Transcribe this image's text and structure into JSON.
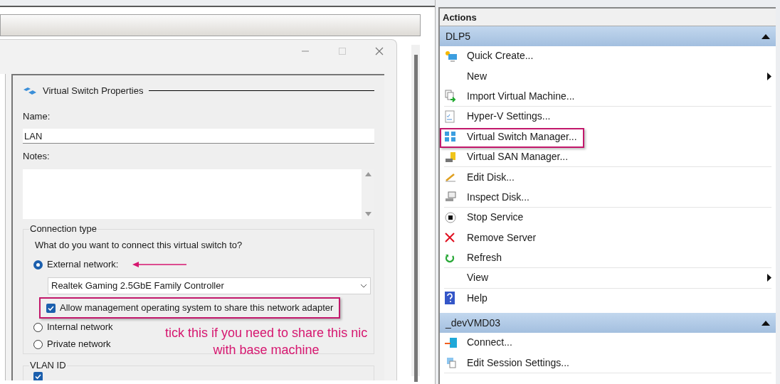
{
  "dialog": {
    "section_title": "Virtual Switch Properties",
    "name_label": "Name:",
    "name_value": "LAN",
    "notes_label": "Notes:",
    "connection_type": {
      "legend": "Connection type",
      "question": "What do you want to connect this virtual switch to?",
      "options": [
        {
          "label": "External network:",
          "selected": true,
          "arrow": true
        },
        {
          "label": "Internal network",
          "selected": false,
          "arrow": false
        },
        {
          "label": "Private network",
          "selected": false,
          "arrow": false
        }
      ],
      "adapter": "Realtek Gaming 2.5GbE Family Controller",
      "share_checkbox": {
        "label": "Allow management operating system to share this network adapter",
        "checked": true,
        "highlighted": true
      }
    },
    "vlan": {
      "legend": "VLAN ID",
      "checked": true
    }
  },
  "annotation": [
    "tick this if you need to share this nic",
    "with base machine"
  ],
  "actions": {
    "title": "Actions",
    "groups": [
      {
        "name": "DLP5",
        "expanded": true,
        "items": [
          {
            "label": "Quick Create...",
            "kind": "quick-create",
            "submenu": false,
            "highlighted": false,
            "separator": false
          },
          {
            "label": "New",
            "kind": "none",
            "submenu": true,
            "highlighted": false,
            "separator": false
          },
          {
            "label": "Import Virtual Machine...",
            "kind": "import",
            "submenu": false,
            "highlighted": false,
            "separator": true
          },
          {
            "label": "Hyper-V Settings...",
            "kind": "settings",
            "submenu": false,
            "highlighted": false,
            "separator": false
          },
          {
            "label": "Virtual Switch Manager...",
            "kind": "switch",
            "submenu": false,
            "highlighted": true,
            "separator": false
          },
          {
            "label": "Virtual SAN Manager...",
            "kind": "san",
            "submenu": false,
            "highlighted": false,
            "separator": true
          },
          {
            "label": "Edit Disk...",
            "kind": "edit-disk",
            "submenu": false,
            "highlighted": false,
            "separator": false
          },
          {
            "label": "Inspect Disk...",
            "kind": "inspect",
            "submenu": false,
            "highlighted": false,
            "separator": true
          },
          {
            "label": "Stop Service",
            "kind": "stop",
            "submenu": false,
            "highlighted": false,
            "separator": false
          },
          {
            "label": "Remove Server",
            "kind": "remove",
            "submenu": false,
            "highlighted": false,
            "separator": false
          },
          {
            "label": "Refresh",
            "kind": "refresh",
            "submenu": false,
            "highlighted": false,
            "separator": true
          },
          {
            "label": "View",
            "kind": "none",
            "submenu": true,
            "highlighted": false,
            "separator": true
          },
          {
            "label": "Help",
            "kind": "help",
            "submenu": false,
            "highlighted": false,
            "separator": false
          }
        ]
      },
      {
        "name": "_devVMD03",
        "expanded": true,
        "items": [
          {
            "label": "Connect...",
            "kind": "connect",
            "submenu": false,
            "highlighted": false,
            "separator": false
          },
          {
            "label": "Edit Session Settings...",
            "kind": "session",
            "submenu": false,
            "highlighted": false,
            "separator": true
          }
        ]
      }
    ]
  }
}
